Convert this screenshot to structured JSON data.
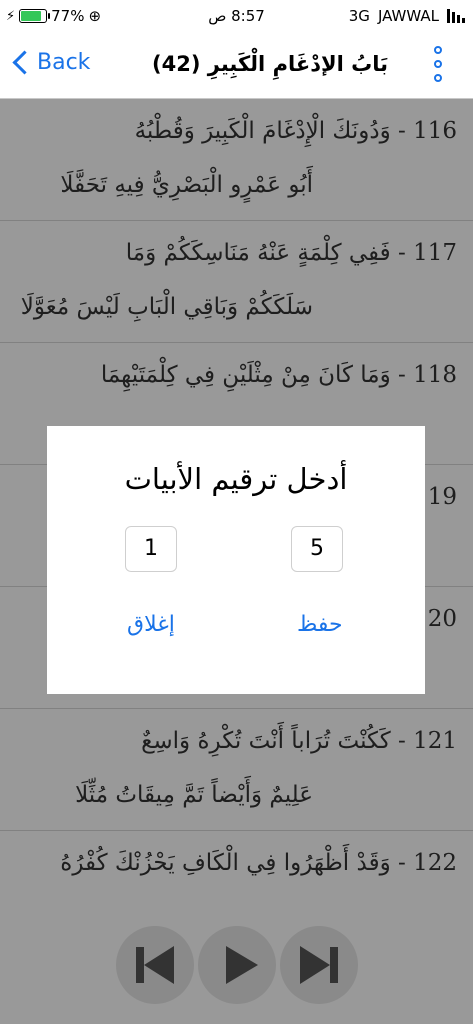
{
  "status_bar": {
    "battery": "77%",
    "time": "8:57 ص",
    "network": "3G",
    "carrier": "JAWWAL",
    "battery_level": 0.77,
    "battery_color": "#34c759"
  },
  "nav": {
    "back_label": "Back",
    "title": "بَابُ الإدْغَامِ الْكَبِيرِ (42)",
    "menu_icon": "vertical-dots-icon",
    "accent": "#1a73e8"
  },
  "verses": [
    {
      "number": "116 -",
      "line1": "وَدُونَكَ الْإِدْغَامَ الْكَبِيرَ وَقُطْبُهُ",
      "line2": "أَبُو عَمْرٍو الْبَصْرِيُّ فِيهِ تَحَفَّلَا"
    },
    {
      "number": "117 -",
      "line1": "فَفِي كِلْمَةٍ عَنْهُ مَنَاسِكَكُمْ وَمَا",
      "line2": "سَلَكَكُمْ وَبَاقِي الْبَابِ لَيْسَ مُعَوَّلَا"
    },
    {
      "number": "118 -",
      "line1": "وَمَا كَانَ مِنْ مِثْلَيْنِ فِي كِلْمَتَيْهِمَا",
      "line2": ""
    },
    {
      "number": "119",
      "line1": "",
      "line2": ""
    },
    {
      "number": "120",
      "line1": "",
      "line2": ""
    },
    {
      "number": "121 -",
      "line1": "كَكُنْتَ تُرَاباً أَنْتَ تُكْرِهُ وَاسِعٌ",
      "line2": "عَلِيمٌ وَأَيْضاً تَمَّ مِيقَاتُ مُثِّلَا"
    },
    {
      "number": "122 -",
      "line1": "وَقَدْ أَظْهَرُوا فِي الْكَافِ يَحْزُنْكَ كُفْرُهُ",
      "line2": ""
    }
  ],
  "dialog": {
    "title": "أدخل ترقيم الأبيات",
    "to_value": "5",
    "from_value": "1",
    "save_label": "حفظ",
    "close_label": "إغلاق"
  },
  "media": {
    "prev_icon": "skip-previous-icon",
    "play_icon": "play-icon",
    "next_icon": "skip-next-icon"
  }
}
